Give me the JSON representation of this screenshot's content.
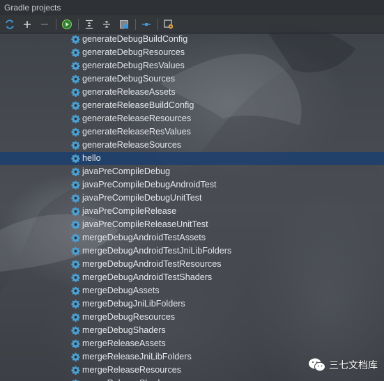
{
  "panel": {
    "title": "Gradle projects"
  },
  "toolbar": {
    "buttons": [
      {
        "icon": "refresh-icon"
      },
      {
        "icon": "add-icon"
      },
      {
        "icon": "remove-icon"
      },
      {
        "icon": "execute-task-icon"
      },
      {
        "icon": "expand-all-icon"
      },
      {
        "icon": "collapse-all-icon"
      },
      {
        "icon": "toggle-offline-icon"
      },
      {
        "icon": "show-dependencies-icon"
      },
      {
        "icon": "settings-icon"
      }
    ]
  },
  "tree": {
    "selected_index": 9,
    "tasks": [
      {
        "label": "generateDebugBuildConfig"
      },
      {
        "label": "generateDebugResources"
      },
      {
        "label": "generateDebugResValues"
      },
      {
        "label": "generateDebugSources"
      },
      {
        "label": "generateReleaseAssets"
      },
      {
        "label": "generateReleaseBuildConfig"
      },
      {
        "label": "generateReleaseResources"
      },
      {
        "label": "generateReleaseResValues"
      },
      {
        "label": "generateReleaseSources"
      },
      {
        "label": "hello"
      },
      {
        "label": "javaPreCompileDebug"
      },
      {
        "label": "javaPreCompileDebugAndroidTest"
      },
      {
        "label": "javaPreCompileDebugUnitTest"
      },
      {
        "label": "javaPreCompileRelease"
      },
      {
        "label": "javaPreCompileReleaseUnitTest"
      },
      {
        "label": "mergeDebugAndroidTestAssets"
      },
      {
        "label": "mergeDebugAndroidTestJniLibFolders"
      },
      {
        "label": "mergeDebugAndroidTestResources"
      },
      {
        "label": "mergeDebugAndroidTestShaders"
      },
      {
        "label": "mergeDebugAssets"
      },
      {
        "label": "mergeDebugJniLibFolders"
      },
      {
        "label": "mergeDebugResources"
      },
      {
        "label": "mergeDebugShaders"
      },
      {
        "label": "mergeReleaseAssets"
      },
      {
        "label": "mergeReleaseJniLibFolders"
      },
      {
        "label": "mergeReleaseResources"
      },
      {
        "label": "mergeReleaseShaders"
      }
    ]
  },
  "watermark": {
    "text": "三七文档库",
    "icon": "wechat-icon"
  },
  "colors": {
    "selection": "#1f406c",
    "gear": "#4aa3d8",
    "text": "#e4e7ea"
  }
}
